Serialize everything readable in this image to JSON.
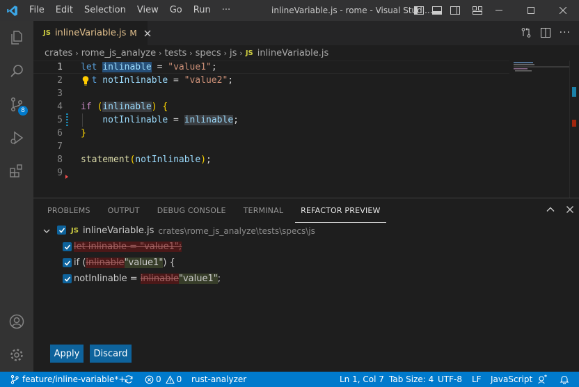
{
  "menu": [
    "File",
    "Edit",
    "Selection",
    "View",
    "Go",
    "Run",
    "···"
  ],
  "window_title": "inlineVariable.js - rome - Visual Studi...",
  "tab": {
    "badge": "JS",
    "name": "inlineVariable.js",
    "modified": "M"
  },
  "breadcrumb": [
    "crates",
    "rome_js_analyze",
    "tests",
    "specs",
    "js",
    "inlineVariable.js"
  ],
  "breadcrumb_file_badge": "JS",
  "activity": {
    "scm_badge": "8"
  },
  "editor": {
    "line_numbers": [
      "1",
      "2",
      "3",
      "4",
      "5",
      "6",
      "7",
      "8",
      "9"
    ],
    "lines": {
      "l1": {
        "kw": "let",
        "var": "inlinable",
        "eq": " = ",
        "str": "\"value1\"",
        "end": ";"
      },
      "l2": {
        "kw": "let",
        "kw_visible": "t",
        "var": "notInlinable",
        "eq": " = ",
        "str": "\"value2\"",
        "end": ";"
      },
      "l4": {
        "kw": "if",
        "open": "(",
        "var": "inlinable",
        "close": ")",
        "brace": "{"
      },
      "l5": {
        "var1": "notInlinable",
        "eq": " = ",
        "var2": "inlinable",
        "end": ";"
      },
      "l6": {
        "brace": "}"
      },
      "l8": {
        "fn": "statement",
        "open": "(",
        "var": "notInlinable",
        "close": ")",
        "end": ";"
      }
    }
  },
  "panel": {
    "tabs": [
      "PROBLEMS",
      "OUTPUT",
      "DEBUG CONSOLE",
      "TERMINAL",
      "REFACTOR PREVIEW"
    ],
    "active_tab": "REFACTOR PREVIEW",
    "file": {
      "badge": "JS",
      "name": "inlineVariable.js",
      "path": "crates\\rome_js_analyze\\tests\\specs\\js"
    },
    "changes": [
      {
        "deleted": "let inlinable = \"value1\";"
      },
      {
        "prefix": "if (",
        "deleted": "inlinable",
        "inserted": "\"value1\"",
        "suffix": ") {"
      },
      {
        "prefix": "notInlinable = ",
        "deleted": "inlinable",
        "inserted": "\"value1\"",
        "suffix": ";"
      }
    ],
    "apply_label": "Apply",
    "discard_label": "Discard"
  },
  "status": {
    "branch": "feature/inline-variable*+",
    "errors": "0",
    "warnings": "0",
    "extension": "rust-analyzer",
    "position": "Ln 1, Col 7",
    "tab_size": "Tab Size: 4",
    "encoding": "UTF-8",
    "eol": "LF",
    "language": "JavaScript"
  },
  "colors": {
    "accent": "#007acc",
    "button": "#0e639c",
    "deleted_bg": "#4b1818",
    "inserted_bg": "#373d29",
    "modified_tab": "#e2c08d"
  }
}
